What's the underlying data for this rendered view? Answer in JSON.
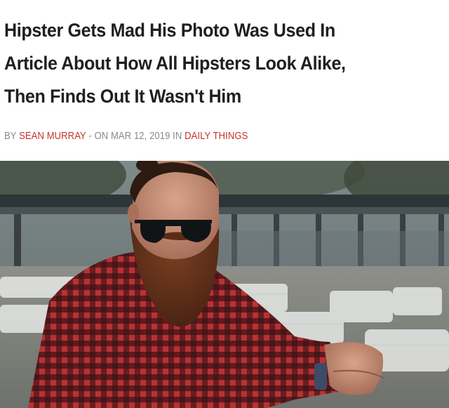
{
  "article": {
    "headline_lines": [
      "Hipster Gets Mad His Photo Was Used In",
      "Article About How All Hipsters Look Alike,",
      "Then Finds Out It Wasn't Him"
    ],
    "byline": {
      "by": "BY",
      "author": "SEAN MURRAY",
      "sep": "-",
      "on": "ON MAR 12, 2019 IN",
      "category": "DAILY THINGS"
    }
  },
  "photo": {
    "subject": "bearded man with top-knot, dark sunglasses and red plaid flannel shirt, seated leaning on his arms; white chairs and a pavilion blurred in background"
  },
  "colors": {
    "headline": "#1f1f1f",
    "byline": "#8a8a8a",
    "accent": "#c8322d"
  }
}
